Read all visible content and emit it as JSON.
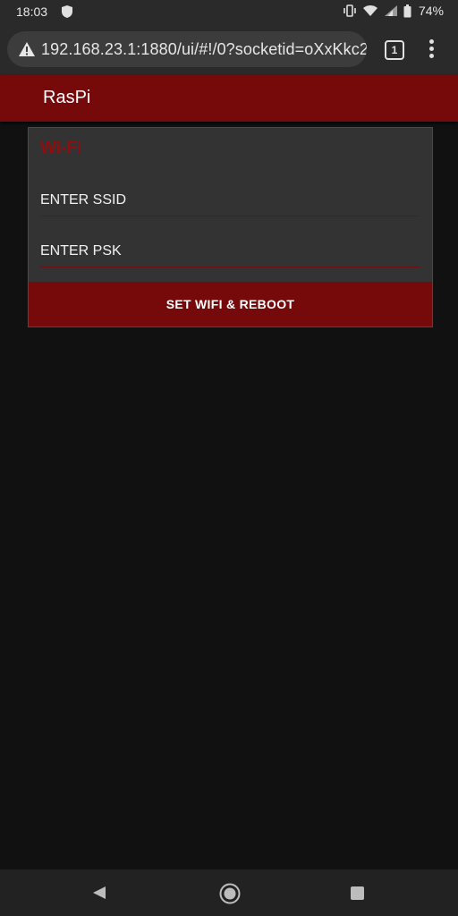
{
  "status_bar": {
    "time": "18:03",
    "battery_percent": "74%",
    "icons": [
      "shield-icon",
      "vibrate-icon",
      "wifi-icon",
      "signal-icon",
      "battery-icon"
    ]
  },
  "browser": {
    "url": "192.168.23.1:1880/ui/#!/0?socketid=oXxKkc2",
    "tab_count": "1",
    "icons": [
      "warning-icon",
      "tab-switcher-icon",
      "overflow-menu-icon"
    ]
  },
  "app": {
    "title": "RasPi",
    "accent_color": "#760a0a"
  },
  "wifi_card": {
    "title": "Wi-Fi",
    "ssid_placeholder": "ENTER SSID",
    "ssid_value": "",
    "psk_placeholder": "ENTER PSK",
    "psk_value": "",
    "button_label": "SET WIFI & REBOOT"
  },
  "nav_bar": {
    "icons": [
      "back-icon",
      "home-icon",
      "recents-icon"
    ]
  }
}
